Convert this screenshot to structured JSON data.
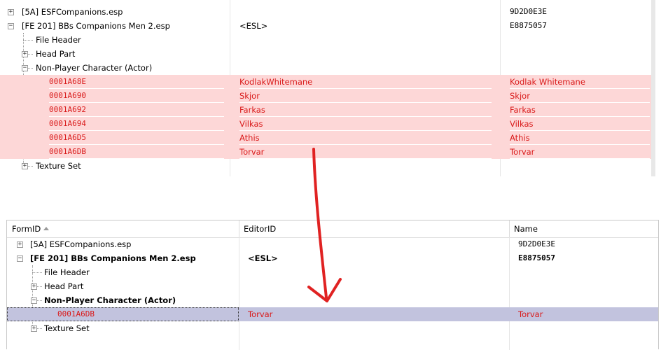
{
  "top_tree": {
    "rows": [
      {
        "form_id": "[5A] ESFCompanions.esp",
        "editor_id": "",
        "name": "9D2D0E3E"
      },
      {
        "form_id": "[FE 201] BBs Companions Men 2.esp",
        "editor_id": "<ESL>",
        "name": "E8875057"
      },
      {
        "form_id": "File Header",
        "editor_id": "",
        "name": ""
      },
      {
        "form_id": "Head Part",
        "editor_id": "",
        "name": ""
      },
      {
        "form_id": "Non-Player Character (Actor)",
        "editor_id": "",
        "name": ""
      },
      {
        "form_id": "0001A68E",
        "editor_id": "KodlakWhitemane",
        "name": "Kodlak Whitemane"
      },
      {
        "form_id": "0001A690",
        "editor_id": "Skjor",
        "name": "Skjor"
      },
      {
        "form_id": "0001A692",
        "editor_id": "Farkas",
        "name": "Farkas"
      },
      {
        "form_id": "0001A694",
        "editor_id": "Vilkas",
        "name": "Vilkas"
      },
      {
        "form_id": "0001A6D5",
        "editor_id": "Athis",
        "name": "Athis"
      },
      {
        "form_id": "0001A6DB",
        "editor_id": "Torvar",
        "name": "Torvar"
      },
      {
        "form_id": "Texture Set",
        "editor_id": "",
        "name": ""
      }
    ]
  },
  "bottom_tree": {
    "columns": {
      "form_id": "FormID",
      "editor_id": "EditorID",
      "name": "Name"
    },
    "rows": [
      {
        "form_id": "[5A] ESFCompanions.esp",
        "editor_id": "",
        "name": "9D2D0E3E"
      },
      {
        "form_id": "[FE 201] BBs Companions Men 2.esp",
        "editor_id": "<ESL>",
        "name": "E8875057"
      },
      {
        "form_id": "File Header",
        "editor_id": "",
        "name": ""
      },
      {
        "form_id": "Head Part",
        "editor_id": "",
        "name": ""
      },
      {
        "form_id": "Non-Player Character (Actor)",
        "editor_id": "",
        "name": ""
      },
      {
        "form_id": "0001A6DB",
        "editor_id": "Torvar",
        "name": "Torvar"
      },
      {
        "form_id": "Texture Set",
        "editor_id": "",
        "name": ""
      }
    ]
  },
  "expander_glyphs": {
    "collapsed": "+",
    "expanded": "−"
  },
  "colors": {
    "conflict_row": "#fdd7d7",
    "conflict_text": "#d91a1a",
    "selected_row": "#c2c3de",
    "arrow": "#e02222"
  }
}
